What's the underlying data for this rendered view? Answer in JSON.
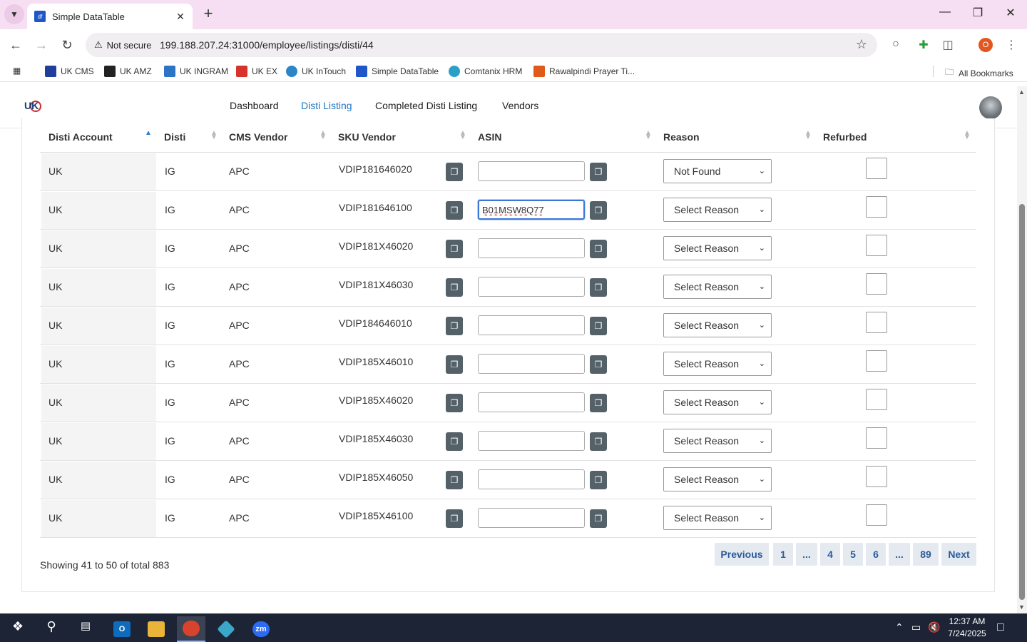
{
  "browser": {
    "tab_title": "Simple DataTable",
    "tab_favicon": "df",
    "security_label": "Not secure",
    "url": "199.188.207.24:31000/employee/listings/disti/44",
    "profile_initial": "O",
    "bookmarks": [
      {
        "label": "UK CMS",
        "color": "#1f3f9a"
      },
      {
        "label": "UK AMZ",
        "color": "#222222"
      },
      {
        "label": "UK INGRAM",
        "color": "#2d73c6"
      },
      {
        "label": "UK EX",
        "color": "#d8332a"
      },
      {
        "label": "UK InTouch",
        "color": "#2b86c5"
      },
      {
        "label": "Simple DataTable",
        "color": "#1f57c9"
      },
      {
        "label": "Comtanix HRM",
        "color": "#2aa0c8"
      },
      {
        "label": "Rawalpindi Prayer Ti...",
        "color": "#e05a1a"
      }
    ],
    "all_bookmarks": "All Bookmarks"
  },
  "nav": {
    "links": [
      "Dashboard",
      "Disti Listing",
      "Completed Disti Listing",
      "Vendors"
    ],
    "active": "Disti Listing"
  },
  "table": {
    "headers": [
      "Disti Account",
      "Disti",
      "CMS Vendor",
      "SKU Vendor",
      "ASIN",
      "Reason",
      "Refurbed"
    ],
    "rows": [
      {
        "account": "UK",
        "disti": "IG",
        "vendor": "APC",
        "sku": "VDIP181646020",
        "asin": "",
        "reason": "Not Found",
        "refurbed": false
      },
      {
        "account": "UK",
        "disti": "IG",
        "vendor": "APC",
        "sku": "VDIP181646100",
        "asin": "B01MSW8Q77",
        "reason": "Select Reason",
        "refurbed": false
      },
      {
        "account": "UK",
        "disti": "IG",
        "vendor": "APC",
        "sku": "VDIP181X46020",
        "asin": "",
        "reason": "Select Reason",
        "refurbed": false
      },
      {
        "account": "UK",
        "disti": "IG",
        "vendor": "APC",
        "sku": "VDIP181X46030",
        "asin": "",
        "reason": "Select Reason",
        "refurbed": false
      },
      {
        "account": "UK",
        "disti": "IG",
        "vendor": "APC",
        "sku": "VDIP184646010",
        "asin": "",
        "reason": "Select Reason",
        "refurbed": false
      },
      {
        "account": "UK",
        "disti": "IG",
        "vendor": "APC",
        "sku": "VDIP185X46010",
        "asin": "",
        "reason": "Select Reason",
        "refurbed": false
      },
      {
        "account": "UK",
        "disti": "IG",
        "vendor": "APC",
        "sku": "VDIP185X46020",
        "asin": "",
        "reason": "Select Reason",
        "refurbed": false
      },
      {
        "account": "UK",
        "disti": "IG",
        "vendor": "APC",
        "sku": "VDIP185X46030",
        "asin": "",
        "reason": "Select Reason",
        "refurbed": false
      },
      {
        "account": "UK",
        "disti": "IG",
        "vendor": "APC",
        "sku": "VDIP185X46050",
        "asin": "",
        "reason": "Select Reason",
        "refurbed": false
      },
      {
        "account": "UK",
        "disti": "IG",
        "vendor": "APC",
        "sku": "VDIP185X46100",
        "asin": "",
        "reason": "Select Reason",
        "refurbed": false
      }
    ]
  },
  "footer": {
    "showing": "Showing 41 to 50 of total 883",
    "pagination": [
      "Previous",
      "1",
      "...",
      "4",
      "5",
      "6",
      "...",
      "89",
      "Next"
    ]
  },
  "taskbar": {
    "time": "12:37 AM",
    "date": "7/24/2025"
  },
  "colors": {
    "accent": "#1f77c4",
    "copy_button": "#556169",
    "pager_bg": "#e5eaf1",
    "tabstrip": "#f6dff2"
  }
}
